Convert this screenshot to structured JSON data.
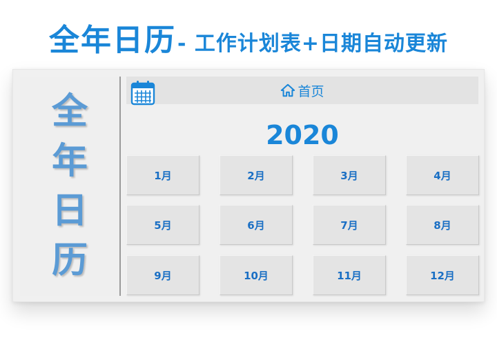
{
  "header": {
    "title_main": "全年日历",
    "title_sub": "- 工作计划表+日期自动更新"
  },
  "sidebar": {
    "chars": [
      "全",
      "年",
      "日",
      "历"
    ]
  },
  "top_bar": {
    "home_label": "首页"
  },
  "year": "2020",
  "months": [
    {
      "label": "1月"
    },
    {
      "label": "2月"
    },
    {
      "label": "3月"
    },
    {
      "label": "4月"
    },
    {
      "label": "5月"
    },
    {
      "label": "6月"
    },
    {
      "label": "7月"
    },
    {
      "label": "8月"
    },
    {
      "label": "9月"
    },
    {
      "label": "10月"
    },
    {
      "label": "11月"
    },
    {
      "label": "12月"
    }
  ],
  "icons": {
    "calendar": "calendar-icon",
    "home": "home-icon"
  },
  "colors": {
    "accent": "#1a86d8",
    "sidebar_text": "#5b9bd5",
    "month_text": "#1a6fc4",
    "button_bg": "#e4e4e4"
  }
}
